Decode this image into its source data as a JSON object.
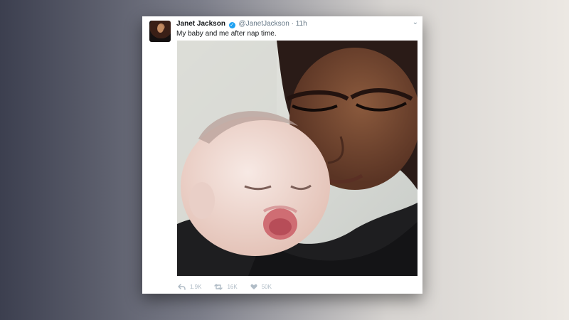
{
  "tweet": {
    "author_name": "Janet Jackson",
    "handle": "@JanetJackson",
    "separator": "·",
    "time": "11h",
    "text": "My baby and me after nap time.",
    "icons": {
      "avatar": "profile-avatar",
      "verified": "verified-badge-icon",
      "menu": "chevron-down-icon",
      "reply": "reply-icon",
      "retweet": "retweet-icon",
      "like": "heart-icon"
    },
    "stats": {
      "replies": "1.9K",
      "retweets": "16K",
      "likes": "50K"
    },
    "colors": {
      "verified": "#1da1f2",
      "text": "#14171a",
      "muted": "#657786"
    }
  }
}
